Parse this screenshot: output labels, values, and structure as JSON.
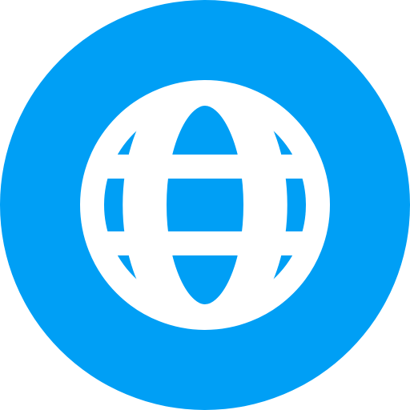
{
  "icon": {
    "name": "globe-icon",
    "background_color": "#009FF5",
    "foreground_color": "#FFFFFF"
  }
}
